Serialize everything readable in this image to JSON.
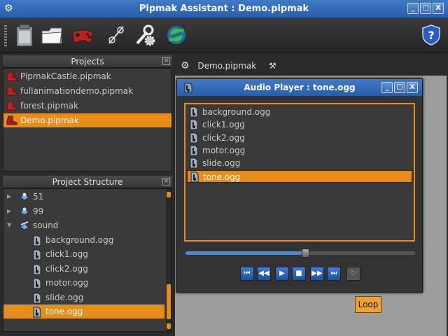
{
  "window": {
    "title": "Pipmak Assistant : Demo.pipmak",
    "min_label": "_",
    "max_label": "□",
    "close_label": "X"
  },
  "toolbar": {
    "tools": [
      "clipboard-icon",
      "folder-icon",
      "gamepad-icon",
      "link-icon",
      "wrench-gear-icon",
      "refresh-icon"
    ],
    "help_icon": "shield-help-icon"
  },
  "projects": {
    "header": "Projects",
    "close": "×",
    "items": [
      {
        "label": "PipmakCastle.pipmak",
        "selected": false
      },
      {
        "label": "fullanimationdemo.pipmak",
        "selected": false
      },
      {
        "label": "forest.pipmak",
        "selected": false
      },
      {
        "label": "Demo.pipmak",
        "selected": true
      }
    ]
  },
  "structure": {
    "header": "Project Structure",
    "close": "×",
    "items": [
      {
        "label": "51",
        "level": 0,
        "arrow": "▶",
        "selected": false,
        "kind": "node"
      },
      {
        "label": "99",
        "level": 0,
        "arrow": "▶",
        "selected": false,
        "kind": "node"
      },
      {
        "label": "sound",
        "level": 0,
        "arrow": "▼",
        "selected": false,
        "kind": "folder"
      },
      {
        "label": "background.ogg",
        "level": 1,
        "arrow": "",
        "selected": false,
        "kind": "audio"
      },
      {
        "label": "click1.ogg",
        "level": 1,
        "arrow": "",
        "selected": false,
        "kind": "audio"
      },
      {
        "label": "click2.ogg",
        "level": 1,
        "arrow": "",
        "selected": false,
        "kind": "audio"
      },
      {
        "label": "motor.ogg",
        "level": 1,
        "arrow": "",
        "selected": false,
        "kind": "audio"
      },
      {
        "label": "slide.ogg",
        "level": 1,
        "arrow": "",
        "selected": false,
        "kind": "audio"
      },
      {
        "label": "tone.ogg",
        "level": 1,
        "arrow": "",
        "selected": true,
        "kind": "audio"
      }
    ]
  },
  "tab": {
    "label": "Demo.pipmak"
  },
  "player": {
    "title": "Audio Player : tone.ogg",
    "files": [
      {
        "label": "background.ogg",
        "selected": false
      },
      {
        "label": "click1.ogg",
        "selected": false
      },
      {
        "label": "click2.ogg",
        "selected": false
      },
      {
        "label": "motor.ogg",
        "selected": false
      },
      {
        "label": "slide.ogg",
        "selected": false
      },
      {
        "label": "tone.ogg",
        "selected": true
      }
    ],
    "progress": 0.52,
    "controls": [
      {
        "name": "skip-start-button",
        "glyph": "⏮",
        "enabled": true
      },
      {
        "name": "rewind-button",
        "glyph": "◀◀",
        "enabled": true
      },
      {
        "name": "play-button",
        "glyph": "▶",
        "enabled": true
      },
      {
        "name": "stop-button",
        "glyph": "■",
        "enabled": true
      },
      {
        "name": "fast-forward-button",
        "glyph": "▶▶",
        "enabled": true
      },
      {
        "name": "skip-end-button",
        "glyph": "⏭",
        "enabled": true
      },
      {
        "name": "loop-button",
        "glyph": "↻",
        "enabled": false
      }
    ],
    "tooltip": "Loop"
  },
  "colors": {
    "accent": "#e88c1a",
    "titlebar": "#3a6fba",
    "control": "#2f6cc4"
  }
}
